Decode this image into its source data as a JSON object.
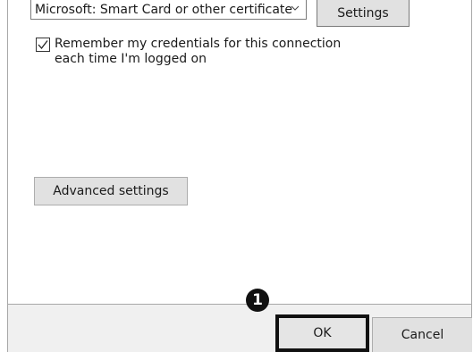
{
  "auth_method": {
    "selected": "Microsoft: Smart Card or other certificate",
    "chevron_icon": "chevron-down-icon"
  },
  "settings_button": {
    "label": "Settings"
  },
  "remember_credentials": {
    "checked": true,
    "label": "Remember my credentials for this connection each time I'm logged on"
  },
  "advanced_button": {
    "label": "Advanced settings"
  },
  "footer": {
    "ok_label": "OK",
    "cancel_label": "Cancel"
  },
  "annotation": {
    "step_number": "1",
    "highlight_color": "#111111"
  }
}
